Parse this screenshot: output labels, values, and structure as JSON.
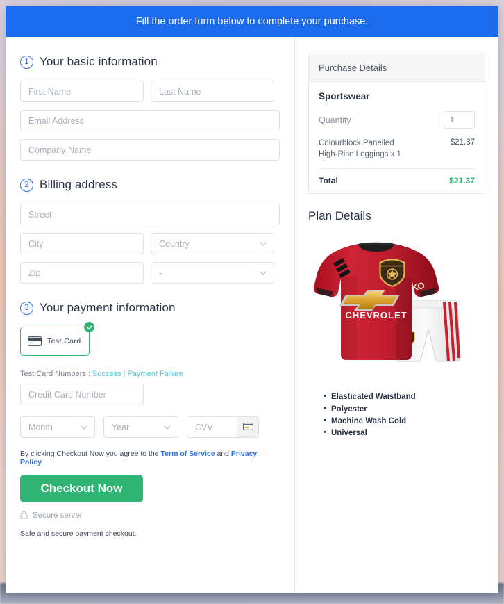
{
  "banner": {
    "text": "Fill the order form below to complete your purchase."
  },
  "sections": {
    "basic": {
      "number": "1",
      "title": "Your basic information",
      "fields": {
        "first_name": "First Name",
        "last_name": "Last Name",
        "email": "Email Address",
        "company": "Company Name"
      }
    },
    "billing": {
      "number": "2",
      "title": "Billing address",
      "fields": {
        "street": "Street",
        "city": "City",
        "country": "Country",
        "zip": "Zip",
        "state": "-"
      }
    },
    "payment": {
      "number": "3",
      "title": "Your payment information",
      "tile_label": "Test Card",
      "test_prefix": "Test Card Numbers : ",
      "test_success": "Success",
      "test_separator": " | ",
      "test_failure": "Payment Failure",
      "card_number": "Credit Card Number",
      "month": "Month",
      "year": "Year",
      "cvv": "CVV"
    }
  },
  "terms": {
    "prefix": "By clicking Checkout Now you agree to the ",
    "tos": "Term of Service",
    "middle": " and ",
    "privacy": "Privacy Policy"
  },
  "actions": {
    "checkout": "Checkout Now",
    "secure_server": "Secure server",
    "safe_note": "Safe and secure payment checkout."
  },
  "purchase": {
    "heading": "Purchase Details",
    "product": "Sportswear",
    "quantity_label": "Quantity",
    "quantity_value": "1",
    "line_item_name": "Colourblock Panelled High-Rise Leggings x 1",
    "line_item_price": "$21.37",
    "total_label": "Total",
    "total_value": "$21.37"
  },
  "plan": {
    "title": "Plan Details",
    "features": [
      "Elasticated Waistband",
      "Polyester",
      "Machine Wash Cold",
      "Universal"
    ],
    "image_alt": "red-football-jersey-and-white-shorts"
  },
  "colors": {
    "banner_blue": "#1a6ced",
    "accent_green": "#2fb573",
    "link_blue": "#2f6fe0",
    "link_cyan": "#4ec8d6",
    "step_blue": "#2f6fe0",
    "jersey_red": "#bd1f30"
  }
}
